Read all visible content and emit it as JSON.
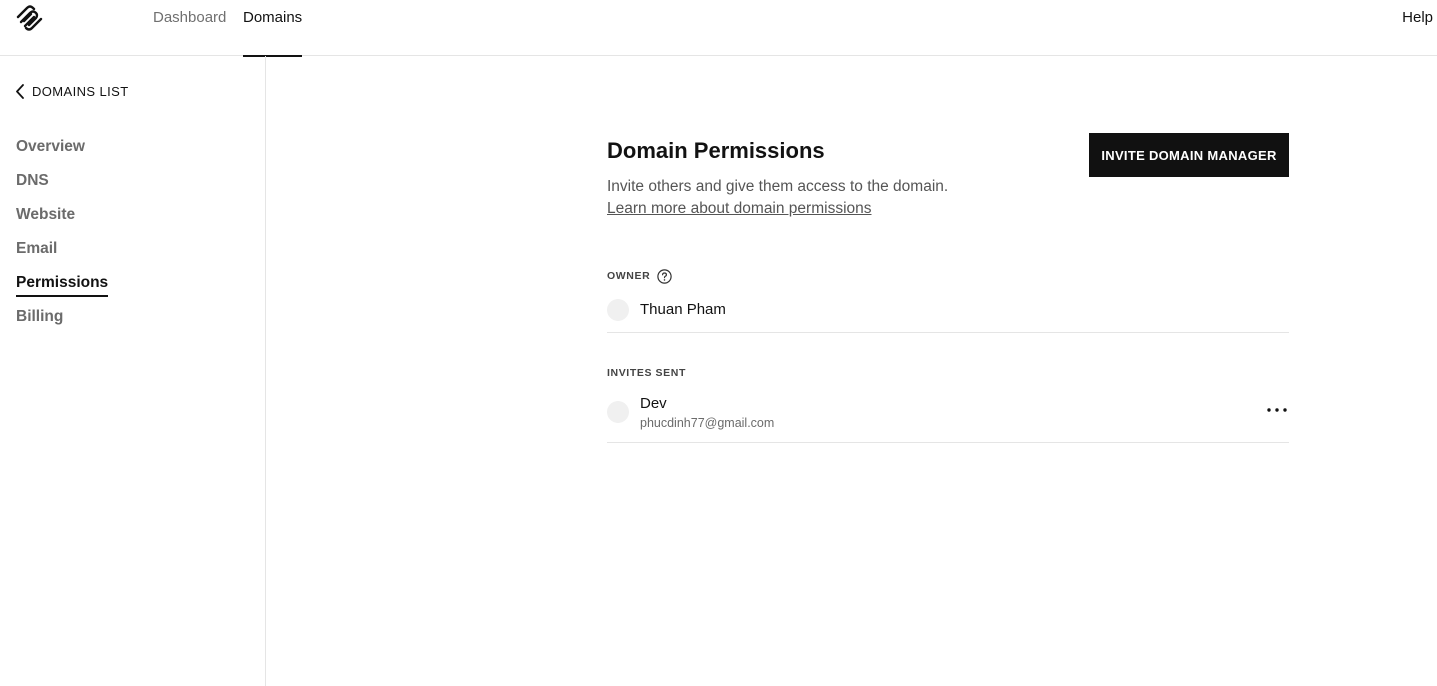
{
  "header": {
    "logo_icon": "squarespace-logo-icon",
    "tabs": [
      {
        "label": "Dashboard",
        "active": false
      },
      {
        "label": "Domains",
        "active": true
      }
    ],
    "help_label": "Help"
  },
  "sidebar": {
    "back_label": "DOMAINS LIST",
    "back_icon": "chevron-left-icon",
    "items": [
      {
        "label": "Overview",
        "active": false
      },
      {
        "label": "DNS",
        "active": false
      },
      {
        "label": "Website",
        "active": false
      },
      {
        "label": "Email",
        "active": false
      },
      {
        "label": "Permissions",
        "active": true
      },
      {
        "label": "Billing",
        "active": false
      }
    ]
  },
  "main": {
    "title": "Domain Permissions",
    "invite_button_label": "INVITE DOMAIN MANAGER",
    "subtitle": "Invite others and give them access to the domain.",
    "learn_more_label": "Learn more about domain permissions",
    "owner": {
      "section_label": "OWNER",
      "help_icon": "question-circle-icon",
      "name": "Thuan Pham"
    },
    "invites": {
      "section_label": "INVITES SENT",
      "items": [
        {
          "name": "Dev",
          "email": "phucdinh77@gmail.com",
          "menu_icon": "more-horizontal-icon"
        }
      ]
    }
  },
  "colors": {
    "text_primary": "#121212",
    "text_secondary": "#6b6b6b",
    "button_bg": "#111111",
    "divider": "#e5e5e5",
    "avatar_bg": "#f0f0f0"
  }
}
